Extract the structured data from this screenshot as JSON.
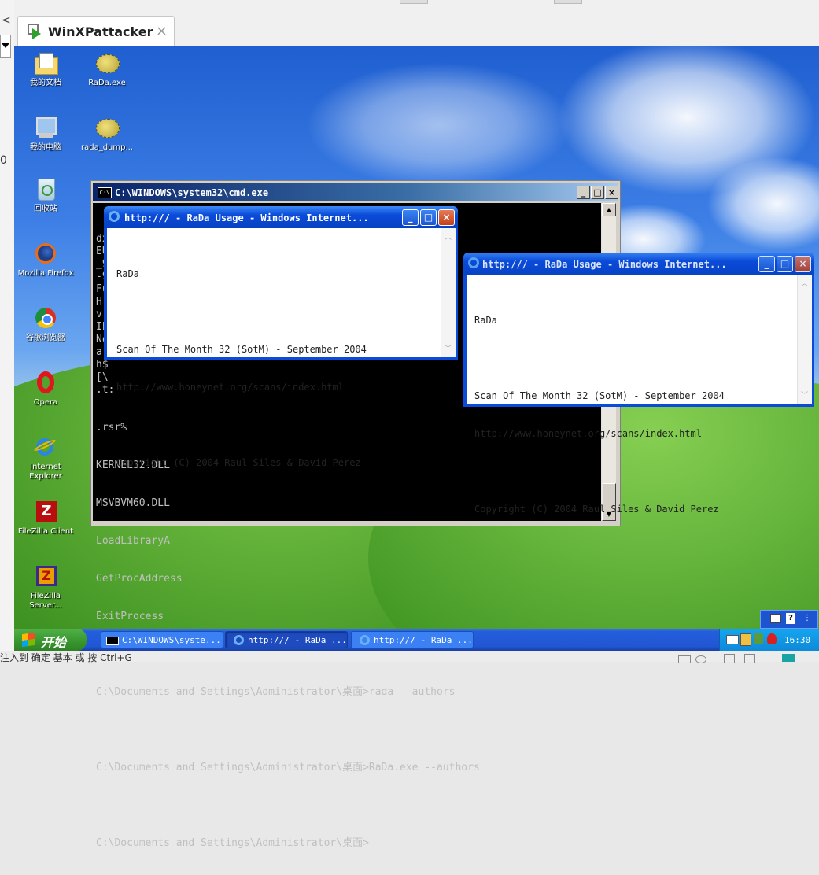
{
  "host": {
    "tab_title": "WinXPattacker",
    "tab_close": "×",
    "left_glyph_top": "<",
    "left_glyph_mid": "0",
    "status_text": "注入到 确定 基本 或 按 Ctrl+G"
  },
  "desktop_icons": [
    {
      "label": "我的文档",
      "icon": "my-documents-icon"
    },
    {
      "label": "RaDa.exe",
      "icon": "blowfish-icon"
    },
    {
      "label": "我的电脑",
      "icon": "my-computer-icon"
    },
    {
      "label": "rada_dump...",
      "icon": "blowfish-icon"
    },
    {
      "label": "回收站",
      "icon": "recycle-bin-icon"
    },
    {
      "label": "Mozilla Firefox",
      "icon": "firefox-icon"
    },
    {
      "label": "谷歌浏览器",
      "icon": "chrome-icon"
    },
    {
      "label": "Opera",
      "icon": "opera-icon"
    },
    {
      "label": "Internet Explorer",
      "icon": "ie-icon"
    },
    {
      "label": "FileZilla Client",
      "icon": "filezilla-icon"
    },
    {
      "label": "FileZilla Server...",
      "icon": "filezilla-server-icon"
    }
  ],
  "cmd": {
    "title": "C:\\WINDOWS\\system32\\cmd.exe",
    "left_chars": [
      "dx",
      "EU",
      "_9",
      "-9",
      "Fu",
      "H",
      "v(",
      "Ih",
      "No",
      "a(",
      "h$",
      "[\\"
    ],
    "lines": [
      ".t:",
      ".rsr%",
      "KERNEL32.DLL",
      "MSVBVM60.DLL",
      "LoadLibraryA",
      "GetProcAddress",
      "ExitProcess",
      "",
      "C:\\Documents and Settings\\Administrator\\桌面>rada --authors",
      "",
      "C:\\Documents and Settings\\Administrator\\桌面>RaDa.exe --authors",
      "",
      "C:\\Documents and Settings\\Administrator\\桌面>"
    ]
  },
  "ie1": {
    "title": "http:/// - RaDa Usage - Windows Internet...",
    "lines": [
      "RaDa",
      "",
      "Scan Of The Month 32 (SotM) - September 2004",
      "http://www.honeynet.org/scans/index.html",
      "",
      "Copyright (C) 2004 Raul Siles & David Perez"
    ]
  },
  "ie2": {
    "title": "http:/// - RaDa Usage - Windows Internet...",
    "lines": [
      "RaDa",
      "",
      "Scan Of The Month 32 (SotM) - September 2004",
      "http://www.honeynet.org/scans/index.html",
      "",
      "Copyright (C) 2004 Raul Siles & David Perez"
    ]
  },
  "taskbar": {
    "start_label": "开始",
    "tasks": [
      {
        "label": "C:\\WINDOWS\\syste...",
        "icon": "cmd-icon"
      },
      {
        "label": "http:/// - RaDa ...",
        "icon": "ie-icon"
      },
      {
        "label": "http:/// - RaDa ...",
        "icon": "ie-icon"
      }
    ],
    "clock": "16:30"
  }
}
